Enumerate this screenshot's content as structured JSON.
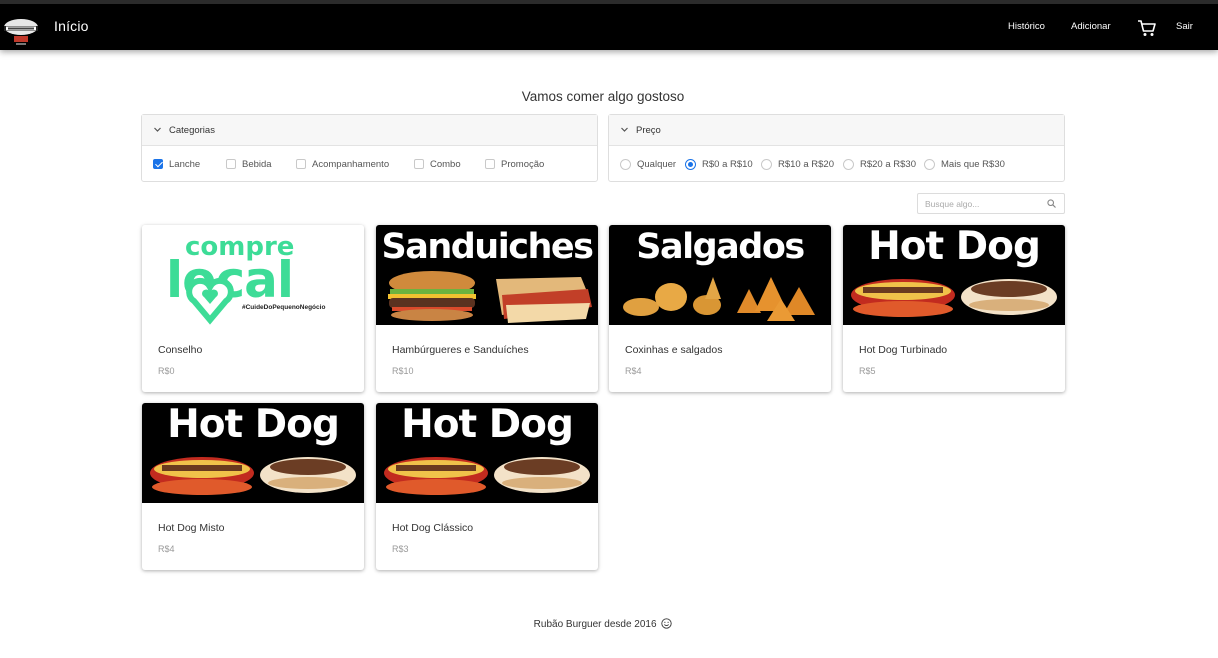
{
  "nav": {
    "brand": "Início",
    "links": {
      "history": "Histórico",
      "add": "Adicionar",
      "logout": "Sair"
    },
    "icons": {
      "logo": "burger-shop-logo",
      "cart": "cart-icon"
    }
  },
  "heading": "Vamos comer algo gostoso",
  "filters": {
    "categories": {
      "title": "Categorias",
      "options": [
        {
          "label": "Lanche",
          "checked": true
        },
        {
          "label": "Bebida",
          "checked": false
        },
        {
          "label": "Acompanhamento",
          "checked": false
        },
        {
          "label": "Combo",
          "checked": false
        },
        {
          "label": "Promoção",
          "checked": false
        }
      ]
    },
    "price": {
      "title": "Preço",
      "options": [
        {
          "label": "Qualquer",
          "selected": false
        },
        {
          "label": "R$0 a R$10",
          "selected": true
        },
        {
          "label": "R$10 a R$20",
          "selected": false
        },
        {
          "label": "R$20 a R$30",
          "selected": false
        },
        {
          "label": "Mais que R$30",
          "selected": false
        }
      ]
    }
  },
  "search": {
    "placeholder": "Busque algo...",
    "value": ""
  },
  "products": [
    {
      "name": "Conselho",
      "price": "R$0",
      "image": {
        "line1": "compre",
        "line2": "local",
        "tagline": "#CuideDoPequenoNegócio",
        "color": "#3ddc97"
      }
    },
    {
      "name": "Hambúrgueres e Sanduíches",
      "price": "R$10",
      "image": {
        "banner": "Sanduiches"
      }
    },
    {
      "name": "Coxinhas e salgados",
      "price": "R$4",
      "image": {
        "banner": "Salgados"
      }
    },
    {
      "name": "Hot Dog Turbinado",
      "price": "R$5",
      "image": {
        "banner": "Hot Dog"
      }
    },
    {
      "name": "Hot Dog Misto",
      "price": "R$4",
      "image": {
        "banner": "Hot Dog"
      }
    },
    {
      "name": "Hot Dog Clássico",
      "price": "R$3",
      "image": {
        "banner": "Hot Dog"
      }
    }
  ],
  "footer": {
    "text": "Rubão Burguer desde 2016"
  },
  "colors": {
    "accent": "#1a73e8",
    "navbar": "#000000"
  }
}
